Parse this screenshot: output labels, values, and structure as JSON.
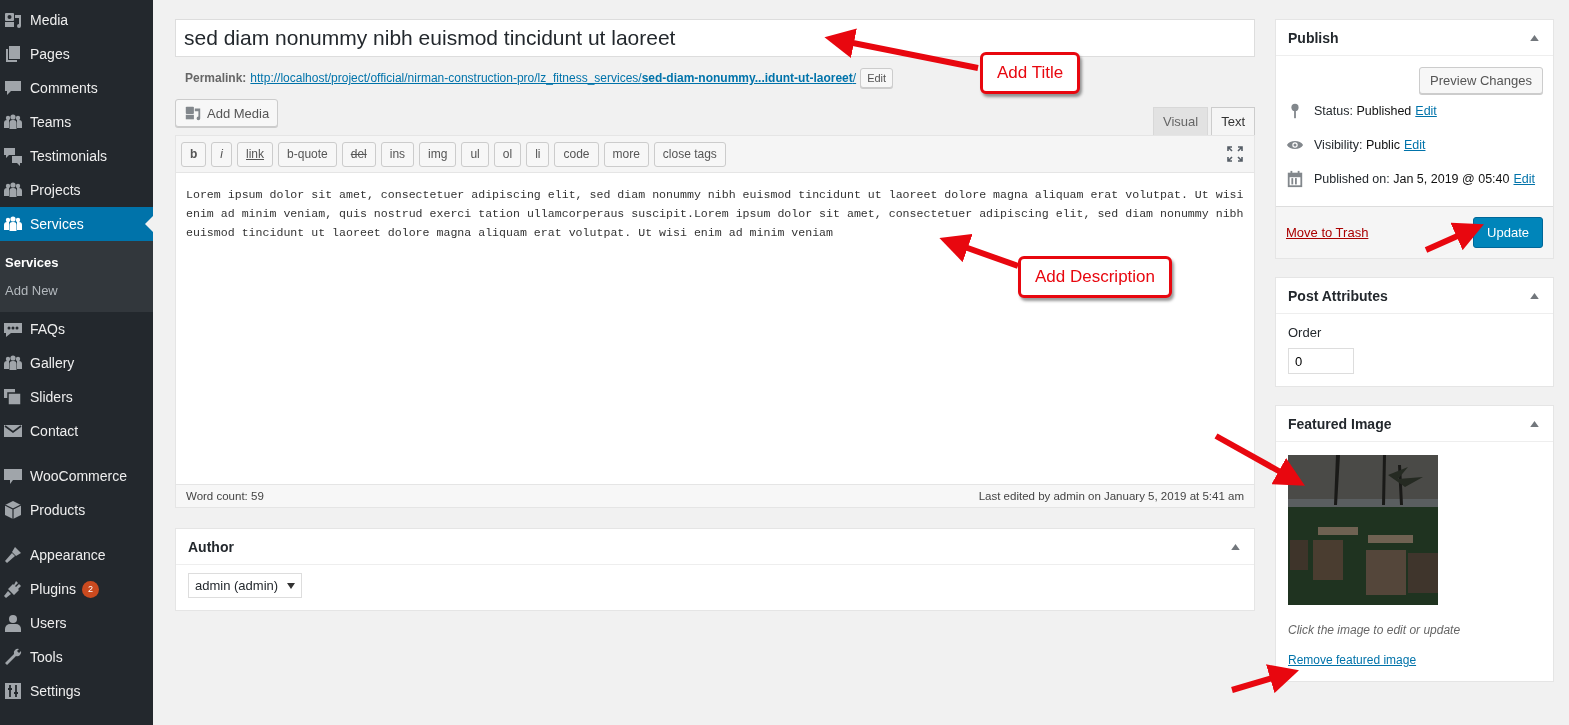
{
  "sidebar": {
    "groups": [
      {
        "items": [
          {
            "label": "Media",
            "selected": false
          },
          {
            "label": "Pages",
            "selected": false
          },
          {
            "label": "Comments",
            "selected": false
          },
          {
            "label": "Teams",
            "selected": false
          },
          {
            "label": "Testimonials",
            "selected": false
          },
          {
            "label": "Projects",
            "selected": false
          },
          {
            "label": "Services",
            "selected": true,
            "children": [
              {
                "label": "Services",
                "selected": true
              },
              {
                "label": "Add New",
                "selected": false
              }
            ]
          },
          {
            "label": "FAQs",
            "selected": false
          },
          {
            "label": "Gallery",
            "selected": false
          },
          {
            "label": "Sliders",
            "selected": false
          },
          {
            "label": "Contact",
            "selected": false
          }
        ]
      },
      {
        "items": [
          {
            "label": "WooCommerce",
            "selected": false
          },
          {
            "label": "Products",
            "selected": false
          }
        ]
      },
      {
        "items": [
          {
            "label": "Appearance",
            "selected": false
          },
          {
            "label": "Plugins",
            "selected": false,
            "badge": "2"
          },
          {
            "label": "Users",
            "selected": false
          },
          {
            "label": "Tools",
            "selected": false
          },
          {
            "label": "Settings",
            "selected": false
          }
        ]
      }
    ]
  },
  "title_field": {
    "value": "sed diam nonummy nibh euismod tincidunt ut laoreet"
  },
  "permalink": {
    "label": "Permalink:",
    "url": "http://localhost/project/official/nirman-construction-pro/lz_fitness_services/",
    "slug": "sed-diam-nonummy...idunt-ut-laoreet",
    "trailing": "/",
    "edit_button": "Edit"
  },
  "add_media_button": "Add Media",
  "editor": {
    "tabs": [
      {
        "label": "Visual",
        "selected": false
      },
      {
        "label": "Text",
        "selected": true
      }
    ],
    "toolbar": [
      {
        "label": "b",
        "kind": "bold"
      },
      {
        "label": "i",
        "kind": "italic"
      },
      {
        "label": "link",
        "kind": "underline"
      },
      {
        "label": "b-quote",
        "kind": "plain"
      },
      {
        "label": "del",
        "kind": "strike"
      },
      {
        "label": "ins",
        "kind": "plain"
      },
      {
        "label": "img",
        "kind": "plain"
      },
      {
        "label": "ul",
        "kind": "plain"
      },
      {
        "label": "ol",
        "kind": "plain"
      },
      {
        "label": "li",
        "kind": "plain"
      },
      {
        "label": "code",
        "kind": "plain"
      },
      {
        "label": "more",
        "kind": "plain"
      },
      {
        "label": "close tags",
        "kind": "plain"
      }
    ],
    "content": "Lorem ipsum dolor sit amet, consectetuer adipiscing elit, sed diam nonummy nibh euismod tincidunt ut laoreet dolore magna aliquam erat volutpat. Ut wisi enim ad minim veniam, quis nostrud exerci tation ullamcorperaus suscipit.Lorem ipsum dolor sit amet, consectetuer adipiscing elit, sed diam nonummy nibh euismod tincidunt ut laoreet dolore magna aliquam erat volutpat. Ut wisi enim ad minim veniam",
    "word_count": "Word count: 59",
    "last_edited": "Last edited by admin on January 5, 2019 at 5:41 am"
  },
  "author_box": {
    "title": "Author",
    "select": "admin (admin)"
  },
  "publish_box": {
    "title": "Publish",
    "preview_button": "Preview Changes",
    "rows": [
      {
        "label": "Status:",
        "value": "Published",
        "link": "Edit"
      },
      {
        "label": "Visibility:",
        "value": "Public",
        "link": "Edit"
      },
      {
        "label": "Published on:",
        "value": "Jan 5, 2019 @ 05:40",
        "link": "Edit"
      }
    ],
    "trash_link": "Move to Trash",
    "update_button": "Update"
  },
  "attributes_box": {
    "title": "Post Attributes",
    "order_label": "Order",
    "order_value": "0"
  },
  "featured_box": {
    "title": "Featured Image",
    "caption": "Click the image to edit or update",
    "remove_link": "Remove featured image"
  },
  "annotations": [
    {
      "text": "Add Title"
    },
    {
      "text": "Add Description"
    }
  ]
}
